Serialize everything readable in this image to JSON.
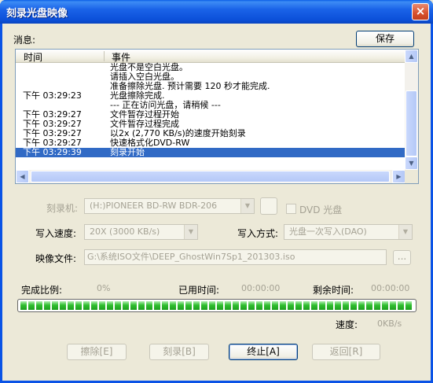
{
  "window": {
    "title": "刻录光盘映像",
    "close_glyph": "×"
  },
  "messages": {
    "label": "消息:",
    "save_button": "保存",
    "columns": [
      "时间",
      "事件"
    ],
    "rows": [
      {
        "time": "",
        "event": "光盘不是空白光盘。"
      },
      {
        "time": "",
        "event": "请插入空白光盘。"
      },
      {
        "time": "",
        "event": "准备擦除光盘. 预计需要 120 秒才能完成."
      },
      {
        "time": "下午 03:29:23",
        "event": "光盘擦除完成."
      },
      {
        "time": "",
        "event": "--- 正在访问光盘，请稍候 ---"
      },
      {
        "time": "下午 03:29:27",
        "event": "文件暂存过程开始"
      },
      {
        "time": "下午 03:29:27",
        "event": "文件暂存过程完成"
      },
      {
        "time": "下午 03:29:27",
        "event": "以2x (2,770 KB/s)的速度开始刻录"
      },
      {
        "time": "下午 03:29:27",
        "event": "快速格式化DVD-RW"
      },
      {
        "time": "下午 03:29:39",
        "event": "刻录开始",
        "selected": true
      }
    ]
  },
  "burner": {
    "label": "刻录机:",
    "value": "(H:)PIONEER  BD-RW   BDR-206",
    "dvd_checkbox_label": "DVD 光盘"
  },
  "speed": {
    "label": "写入速度:",
    "value": "20X (3000 KB/s)"
  },
  "mode": {
    "label": "写入方式:",
    "value": "光盘一次写入(DAO)"
  },
  "image_file": {
    "label": "映像文件:",
    "value": "G:\\系统ISO文件\\DEEP_GhostWin7Sp1_201303.iso",
    "browse": "..."
  },
  "status": {
    "complete_label": "完成比例:",
    "complete_value": "0%",
    "elapsed_label": "已用时间:",
    "elapsed_value": "00:00:00",
    "remaining_label": "剩余时间:",
    "remaining_value": "00:00:00",
    "speed_label": "速度:",
    "speed_value": "0KB/s",
    "progress_fraction": 1.0,
    "progress_color": "#2fbf2f"
  },
  "buttons": {
    "erase": "擦除[E]",
    "burn": "刻录[B]",
    "stop": "终止[A]",
    "back": "返回[R]"
  }
}
